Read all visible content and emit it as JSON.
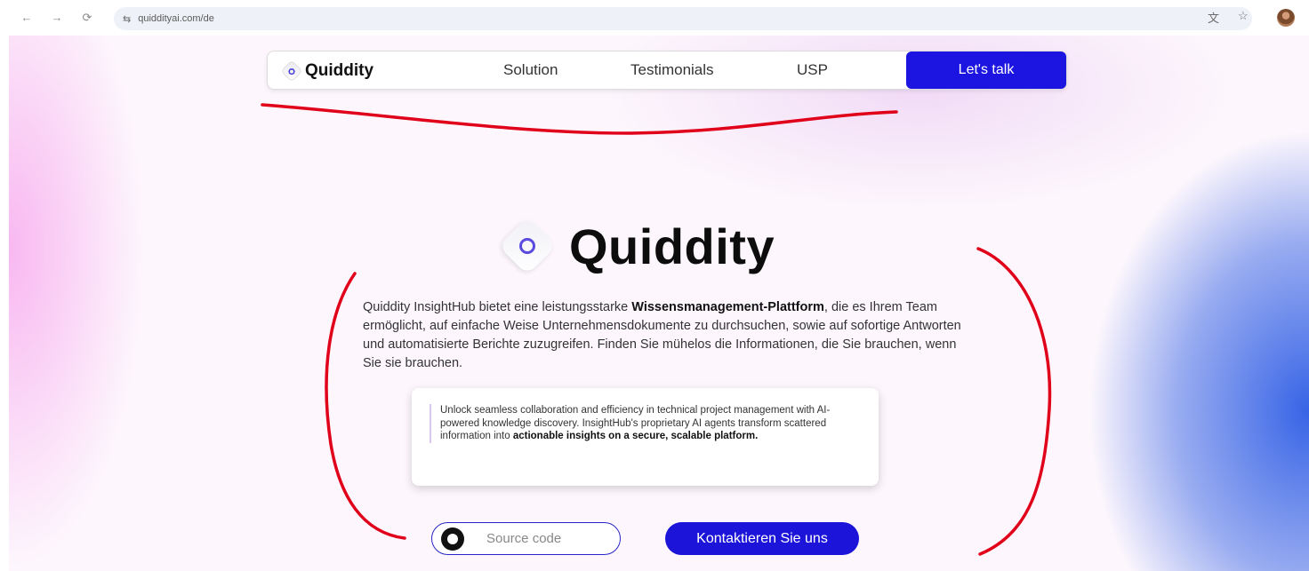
{
  "browser": {
    "url": "quiddityai.com/de",
    "back_icon": "arrow-left-icon",
    "forward_icon": "arrow-right-icon",
    "reload_icon": "reload-icon",
    "translate_icon": "translate-icon",
    "bookmark_icon": "star-icon"
  },
  "nav": {
    "brand": "Quiddity",
    "links": [
      "Solution",
      "Testimonials",
      "USP"
    ],
    "cta": "Let's talk"
  },
  "hero": {
    "brand": "Quiddity",
    "desc_pre": "Quiddity InsightHub bietet eine leistungsstarke ",
    "desc_bold": "Wissensmanagement-Plattform",
    "desc_post": ", die es Ihrem Team ermöglicht, auf einfache Weise Unternehmensdokumente zu durchsuchen, sowie auf sofortige Antworten und automatisierte Berichte zuzugreifen. Finden Sie mühelos die Informationen, die Sie brauchen, wenn Sie sie brauchen.",
    "card_text": "Unlock seamless collaboration and efficiency in technical project management with AI-powered knowledge discovery. InsightHub's proprietary AI agents transform scattered information into ",
    "card_bold": "actionable insights on a secure, scalable platform."
  },
  "buttons": {
    "source": "Source code",
    "contact": "Kontaktieren Sie uns"
  },
  "colors": {
    "accent": "#1c14e0",
    "annotation": "#e0001a"
  }
}
